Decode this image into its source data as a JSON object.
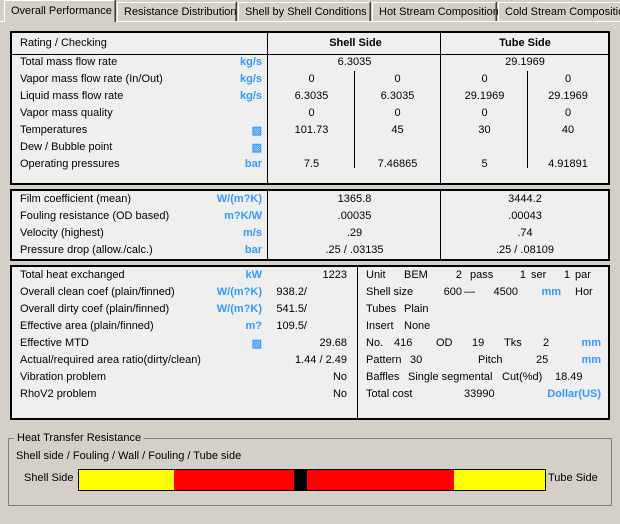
{
  "tabs": [
    {
      "label": "Overall Performance",
      "active": true
    },
    {
      "label": "Resistance Distribution",
      "active": false
    },
    {
      "label": "Shell by Shell Conditions",
      "active": false
    },
    {
      "label": "Hot Stream Composition",
      "active": false
    },
    {
      "label": "Cold Stream Composition",
      "active": false
    }
  ],
  "table": {
    "corner_label": "Rating / Checking",
    "col_shell": "Shell Side",
    "col_tube": "Tube Side",
    "rows": [
      {
        "label": "Total mass flow rate",
        "unit": "kg/s",
        "shell_in": "6.3035",
        "shell_out": "",
        "tube_in": "29.1969",
        "tube_out": "",
        "span": true
      },
      {
        "label": "Vapor mass flow rate  (In/Out)",
        "unit": "kg/s",
        "shell_in": "0",
        "shell_out": "0",
        "tube_in": "0",
        "tube_out": "0",
        "span": false
      },
      {
        "label": "Liquid mass flow rate",
        "unit": "kg/s",
        "shell_in": "6.3035",
        "shell_out": "6.3035",
        "tube_in": "29.1969",
        "tube_out": "29.1969",
        "span": false
      },
      {
        "label": "Vapor mass quality",
        "unit": "",
        "shell_in": "0",
        "shell_out": "0",
        "tube_in": "0",
        "tube_out": "0",
        "span": false
      },
      {
        "label": "Temperatures",
        "unit": "▨",
        "shell_in": "101.73",
        "shell_out": "45",
        "tube_in": "30",
        "tube_out": "40",
        "span": false
      },
      {
        "label": "Dew / Bubble point",
        "unit": "▨",
        "shell_in": "",
        "shell_out": "",
        "tube_in": "",
        "tube_out": "",
        "span": false
      },
      {
        "label": "Operating pressures",
        "unit": "bar",
        "shell_in": "7.5",
        "shell_out": "7.46865",
        "tube_in": "5",
        "tube_out": "4.91891",
        "span": false
      }
    ],
    "rows2": [
      {
        "label": "Film coefficient (mean)",
        "unit": "W/(m?K)",
        "shell": "1365.8",
        "tube": "3444.2"
      },
      {
        "label": "Fouling resistance (OD based)",
        "unit": "m?K/W",
        "shell": ".00035",
        "tube": ".00043"
      },
      {
        "label": "Velocity (highest)",
        "unit": "m/s",
        "shell": ".29",
        "tube": ".74"
      },
      {
        "label": "Pressure drop (allow./calc.)",
        "unit": "bar",
        "shell": ".25  /   .03135",
        "tube": ".25  /   .08109"
      }
    ]
  },
  "summary_left": [
    {
      "label": "Total heat exchanged",
      "unit": "kW",
      "v1": "",
      "v2": "1223"
    },
    {
      "label": "Overall clean coef (plain/finned)",
      "unit": "W/(m?K)",
      "v1": "938.2/",
      "v2": ""
    },
    {
      "label": "Overall dirty coef (plain/finned)",
      "unit": "W/(m?K)",
      "v1": "541.5/",
      "v2": ""
    },
    {
      "label": "Effective area (plain/finned)",
      "unit": "m?",
      "v1": "109.5/",
      "v2": ""
    },
    {
      "label": "Effective MTD",
      "unit": "▨",
      "v1": "",
      "v2": "29.68"
    },
    {
      "label": "Actual/required area ratio(dirty/clean)",
      "unit": "",
      "v1": "1.44    /    2.49",
      "v2": ""
    },
    {
      "label": "Vibration problem",
      "unit": "",
      "v1": "",
      "v2": "No"
    },
    {
      "label": "RhoV2 problem",
      "unit": "",
      "v1": "",
      "v2": "No"
    }
  ],
  "summary_right": {
    "unit_label": "Unit",
    "unit_type": "BEM",
    "unit_pass_n": "2",
    "unit_pass": "pass",
    "unit_ser_n": "1",
    "unit_ser": "ser",
    "unit_par_n": "1",
    "unit_par": "par",
    "shell_size_label": "Shell size",
    "shell_dia": "600",
    "shell_dash": "—",
    "shell_len": "4500",
    "shell_unit": "mm",
    "shell_orient": "Hor",
    "tubes_label": "Tubes",
    "tubes_value": "Plain",
    "insert_label": "Insert",
    "insert_value": "None",
    "no_label": "No.",
    "no_value": "416",
    "od_label": "OD",
    "od_value": "19",
    "tks_label": "Tks",
    "tks_value": "2",
    "tks_unit": "mm",
    "pattern_label": "Pattern",
    "pattern_value": "30",
    "pitch_label": "Pitch",
    "pitch_value": "25",
    "pitch_unit": "mm",
    "baffles_label": "Baffles",
    "baffles_value": "Single segmental",
    "cut_label": "Cut(%d)",
    "cut_value": "18.49",
    "cost_label": "Total cost",
    "cost_value": "33990",
    "cost_unit": "Dollar(US)"
  },
  "resistance": {
    "group_title": "Heat Transfer Resistance",
    "legend": "Shell side / Fouling / Wall / Fouling / Tube side",
    "left_label": "Shell Side",
    "right_label": "Tube Side",
    "segments": [
      {
        "name": "shell-side",
        "color": "#ffff00",
        "pct": 20.4
      },
      {
        "name": "fouling-shell",
        "color": "#ff0000",
        "pct": 25.7
      },
      {
        "name": "wall",
        "color": "#000000",
        "pct": 2.9
      },
      {
        "name": "fouling-tube",
        "color": "#ff0000",
        "pct": 31.4
      },
      {
        "name": "tube-side",
        "color": "#ffff00",
        "pct": 19.6
      }
    ]
  },
  "colors": {
    "unit_blue": "#3399ff",
    "bg": "#d4d0c8",
    "panel": "#efefef"
  }
}
